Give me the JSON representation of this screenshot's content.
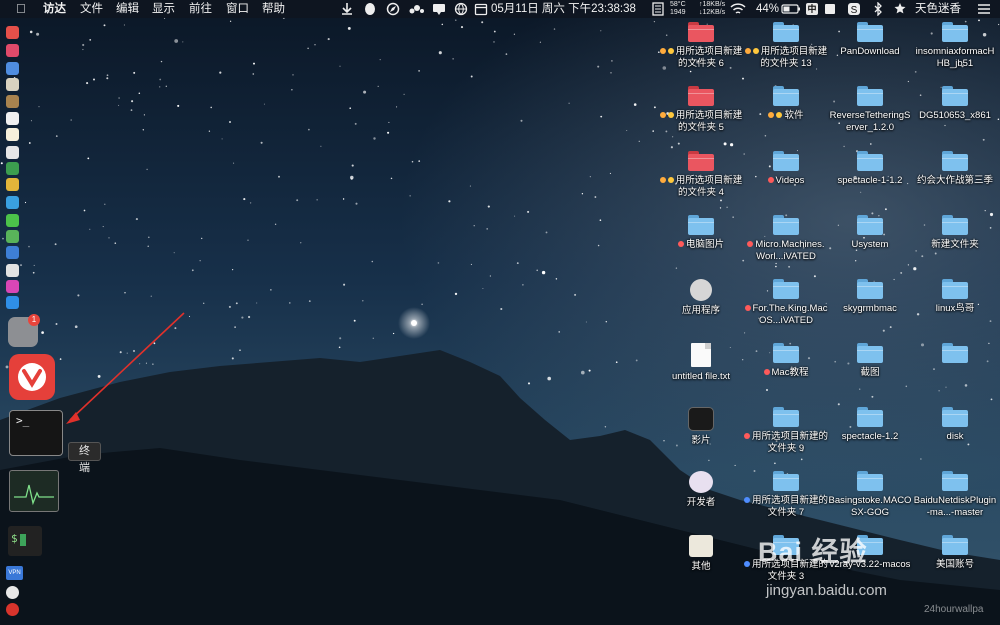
{
  "menubar": {
    "app_name": "访达",
    "menus": [
      "文件",
      "编辑",
      "显示",
      "前往",
      "窗口",
      "帮助"
    ],
    "cpu_temp": "58°C",
    "fan_rpm": "1949",
    "net_up": "↑18KB/s",
    "net_down": "↓12KB/s",
    "clock": "05月11日 周六 下午23:38:38",
    "battery": "44%",
    "input_method": "中",
    "user": "天色迷香"
  },
  "dock": {
    "tooltip": "终端",
    "vpn_label": "VPN",
    "notification_badge": "1"
  },
  "desktop": {
    "col1": [
      {
        "label": "用所选项目新建的文件夹 6",
        "icon": "folder-red",
        "tags": [
          "orange",
          "yellow"
        ]
      },
      {
        "label": "用所选项目新建的文件夹 5",
        "icon": "folder-red",
        "tags": [
          "orange",
          "yellow"
        ]
      },
      {
        "label": "用所选项目新建的文件夹 4",
        "icon": "folder-red",
        "tags": [
          "orange",
          "yellow"
        ]
      },
      {
        "label": "电脑图片",
        "icon": "folder-blue",
        "tags": [
          "red"
        ]
      },
      {
        "label": "应用程序",
        "icon": "apps-folder",
        "tags": []
      },
      {
        "label": "untitled file.txt",
        "icon": "text-file",
        "tags": []
      },
      {
        "label": "影片",
        "icon": "movies-folder",
        "tags": []
      },
      {
        "label": "开发者",
        "icon": "developer-folder",
        "tags": []
      },
      {
        "label": "其他",
        "icon": "other-folder",
        "tags": []
      }
    ],
    "col2": [
      {
        "label": "用所选项目新建的文件夹 13",
        "icon": "folder-blue",
        "tags": [
          "orange",
          "yellow"
        ]
      },
      {
        "label": "软件",
        "icon": "folder-blue",
        "tags": [
          "orange",
          "yellow"
        ]
      },
      {
        "label": "Videos",
        "icon": "folder-teal",
        "tags": [
          "red"
        ]
      },
      {
        "label": "Micro.Machines.Worl...iVATED",
        "icon": "folder-blue",
        "tags": [
          "red"
        ]
      },
      {
        "label": "For.The.King.MacOS...iVATED",
        "icon": "folder-blue",
        "tags": [
          "red"
        ]
      },
      {
        "label": "Mac教程",
        "icon": "folder-blue",
        "tags": [
          "red"
        ]
      },
      {
        "label": "用所选项目新建的文件夹 9",
        "icon": "folder-blue",
        "tags": [
          "red"
        ]
      },
      {
        "label": "用所选项目新建的文件夹 7",
        "icon": "folder-blue",
        "tags": [
          "blue"
        ]
      },
      {
        "label": "用所选项目新建的文件夹 3",
        "icon": "folder-blue",
        "tags": [
          "blue"
        ]
      }
    ],
    "col3": [
      {
        "label": "PanDownload",
        "icon": "folder-blue",
        "tags": []
      },
      {
        "label": "ReverseTetheringServer_1.2.0",
        "icon": "folder-blue",
        "tags": []
      },
      {
        "label": "spectacle-1-1.2",
        "icon": "folder-blue",
        "tags": []
      },
      {
        "label": "Usystem",
        "icon": "folder-blue",
        "tags": []
      },
      {
        "label": "skygrmbmac",
        "icon": "folder-blue",
        "tags": []
      },
      {
        "label": "截图",
        "icon": "folder-blue",
        "tags": []
      },
      {
        "label": "spectacle-1.2",
        "icon": "folder-blue",
        "tags": []
      },
      {
        "label": "Basingstoke.MACOSX-GOG",
        "icon": "folder-blue",
        "tags": []
      },
      {
        "label": "v2ray-v3.22-macos",
        "icon": "folder-blue",
        "tags": []
      }
    ],
    "col4": [
      {
        "label": "insomniaxformacHHB_jb51",
        "icon": "folder-blue",
        "tags": []
      },
      {
        "label": "DG510653_x861",
        "icon": "folder-blue",
        "tags": []
      },
      {
        "label": "约会大作战第三季",
        "icon": "folder-blue",
        "tags": []
      },
      {
        "label": "新建文件夹",
        "icon": "folder-blue",
        "tags": []
      },
      {
        "label": "linux鸟哥",
        "icon": "folder-blue",
        "tags": []
      },
      {
        "label": "",
        "icon": "folder-blue",
        "tags": []
      },
      {
        "label": "disk",
        "icon": "folder-blue",
        "tags": []
      },
      {
        "label": "BaiduNetdiskPlugin-ma...-master",
        "icon": "folder-blue",
        "tags": []
      },
      {
        "label": "美国账号",
        "icon": "folder-blue",
        "tags": []
      }
    ]
  },
  "watermark": {
    "brand": "Bai 经验",
    "url": "jingyan.baidu.com",
    "corner_text": "24hourwallpa"
  }
}
